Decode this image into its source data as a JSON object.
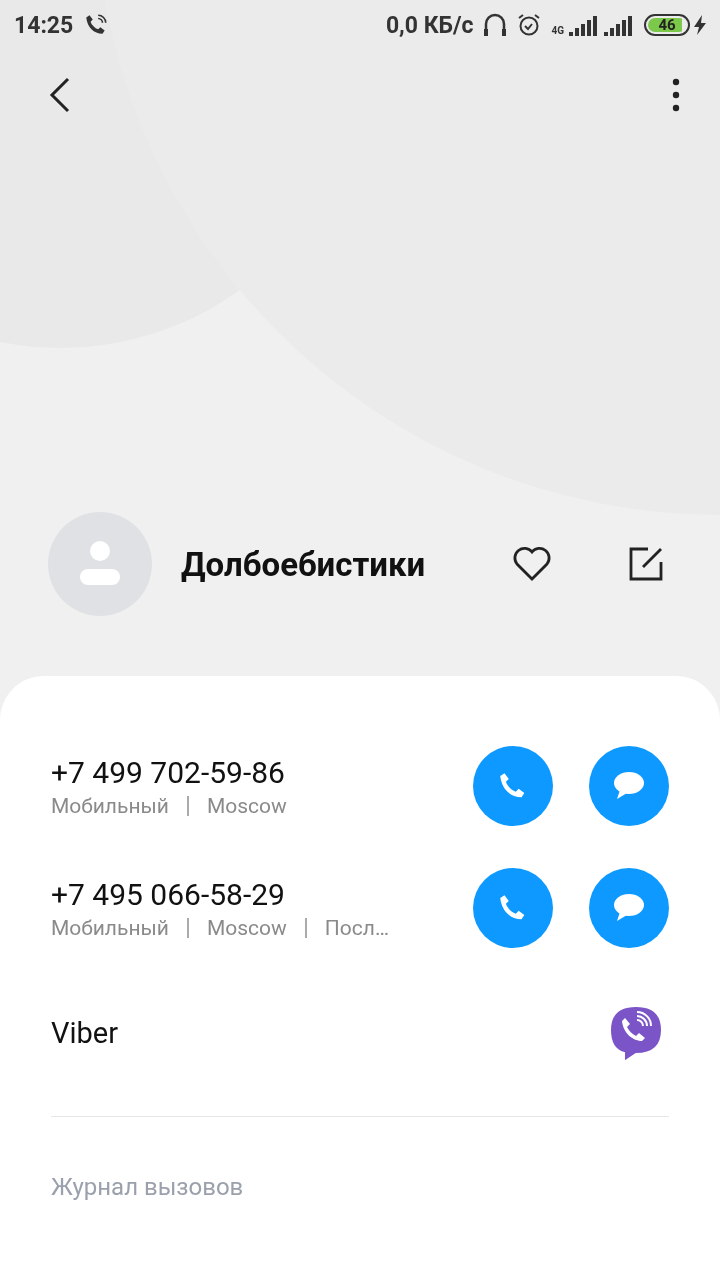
{
  "status_bar": {
    "time": "14:25",
    "speed": "0,0 КБ/с",
    "network": "4G",
    "battery": "46"
  },
  "contact": {
    "name": "Долбоебистики",
    "favorite": false
  },
  "phones": [
    {
      "number": "+7 499 702-59-86",
      "details": [
        "Мобильный",
        "Moscow"
      ]
    },
    {
      "number": "+7 495 066-58-29",
      "details": [
        "Мобильный",
        "Moscow",
        "Посл…"
      ]
    }
  ],
  "apps": [
    {
      "label": "Viber"
    }
  ],
  "section": {
    "label": "Журнал вызовов"
  }
}
